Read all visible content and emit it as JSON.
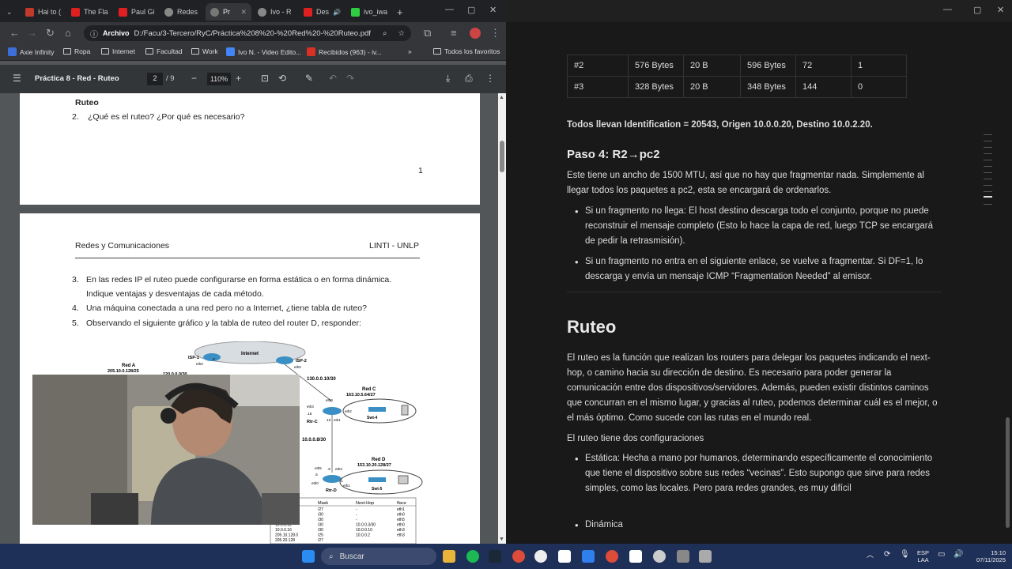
{
  "browser": {
    "tabs": [
      {
        "label": "Hai to ("
      },
      {
        "label": "The Fla"
      },
      {
        "label": "Paul Gi"
      },
      {
        "label": "Redes"
      },
      {
        "label": "Pr"
      },
      {
        "label": "Ivo - R"
      },
      {
        "label": "Des"
      },
      {
        "label": "ivo_iwa"
      }
    ],
    "address_chip": "Archivo",
    "url": "D:/Facu/3-Tercero/RyC/Práctica%208%20-%20Red%20-%20Ruteo.pdf",
    "bookmarks": [
      "Axie Infinity",
      "Ropa",
      "Internet",
      "Facultad",
      "Work",
      "Ivo N. - Video Edito...",
      "Recibidos (963) - iv..."
    ],
    "all_bookmarks": "Todos los favoritos"
  },
  "pdf": {
    "title": "Práctica 8 - Red - Ruteo",
    "page_current": "2",
    "page_total": "/ 9",
    "zoom": "110%",
    "p1_heading": "Ruteo",
    "p1_q2_num": "2.",
    "p1_q2": "¿Qué es el ruteo? ¿Por qué es necesario?",
    "p1_pagenum": "1",
    "p2_header_left": "Redes y Comunicaciones",
    "p2_header_right": "LINTI - UNLP",
    "q3_num": "3.",
    "q3a": "En las redes IP el ruteo puede configurarse en forma estática o en forma dinámica.",
    "q3b": "Indique ventajas y desventajas de cada método.",
    "q4_num": "4.",
    "q4": "Una máquina conectada a una red pero no a Internet, ¿tiene tabla de ruteo?",
    "q5_num": "5.",
    "q5": "Observando el siguiente gráfico y la tabla de ruteo del router D, responder:",
    "diagram": {
      "internet": "Internet",
      "isp1": "ISP-1",
      "isp2": "ISP-2",
      "red_a": "Red A",
      "red_a_net": "205.10.0.128/25",
      "net_120": "120.0.0.0/30",
      "net_130": "130.0.0.10/30",
      "red_c": "Red C",
      "red_c_net": "163.10.5.64/27",
      "rtr_c": "Rtr-C",
      "swt4": "Swt-4",
      "net_10_8": "10.0.0.8/30",
      "red_d": "Red D",
      "red_d_net": "153.10.20.128/27",
      "rtr_d": "Rtr-D",
      "swt5": "Swt-5",
      "eth0": "eth0",
      "eth1": "eth1",
      "eth2": "eth2",
      "eth3": "eth3",
      "eth5": "eth5",
      "n18": ".18",
      "n10": ".10",
      "n9": ".9",
      "n5": ".5",
      "n1": ".1",
      "n2": ".2",
      "table_headers": [
        "Mask",
        "Next-Hop",
        "Iface"
      ],
      "table_rows": [
        [
          "/27",
          "-",
          "eth1"
        ],
        [
          "/30",
          "-",
          "eth0"
        ],
        [
          "/30",
          "-",
          "eth5"
        ],
        [
          "/30",
          "10.0.0.3/30",
          "eth0"
        ],
        [
          "/30",
          "10.0.0.10",
          "eth3"
        ],
        [
          "/25",
          "10.0.0.2",
          "eth3"
        ],
        [
          "/27",
          "",
          ""
        ]
      ],
      "table_dests": [
        "128",
        ".4",
        ".8",
        "10.0.0.12",
        "10.0.0.16",
        "205.10.128.0",
        "205.20.128"
      ]
    }
  },
  "notes": {
    "table_rows": [
      [
        "#2",
        "576 Bytes",
        "20 B",
        "596 Bytes",
        "72",
        "1"
      ],
      [
        "#3",
        "328 Bytes",
        "20 B",
        "348 Bytes",
        "144",
        "0"
      ]
    ],
    "ident_line": "Todos llevan Identification = 20543, Origen 10.0.0.20, Destino 10.0.2.20.",
    "paso4": "Paso 4: R2→pc2",
    "paso4_p": "Este tiene un ancho de 1500 MTU, así que no hay que fragmentar nada. Simplemente al llegar todos los paquetes a pc2, esta se encargará de ordenarlos.",
    "bullet1": "Si un fragmento no llega: El host destino descarga todo el conjunto, porque no puede reconstruir el mensaje completo (Esto lo hace la capa de red, luego TCP se encargará de pedir la retrasmisión).",
    "bullet2": "Si un fragmento no entra en el siguiente enlace, se vuelve a fragmentar. Si DF=1, lo descarga y envía un mensaje ICMP “Fragmentation Needed” al emisor.",
    "ruteo_title": "Ruteo",
    "ruteo_p": "El ruteo es la función que realizan los routers para delegar los paquetes indicando el next-hop, o camino hacia su dirección de destino. Es necesario para poder generar la comunicación entre dos dispositivos/servidores. Además, pueden existir distintos caminos que concurran en el mismo lugar, y gracias al ruteo, podemos determinar cuál es el mejor, o el más óptimo. Como sucede con las rutas en el mundo real.",
    "config_line": "El ruteo tiene dos configuraciones",
    "estatica": "Estática: Hecha a mano por humanos, determinando específicamente el conocimiento que tiene el dispositivo sobre sus redes “vecinas”. Esto supongo que sirve para redes simples, como las locales. Pero para redes grandes, es muy difícil",
    "dinamica": "Dinámica"
  },
  "taskbar": {
    "search": "Buscar",
    "lang1": "ESP",
    "lang2": "LAA",
    "time": "15:10",
    "date": "07/11/2025"
  },
  "colors": {
    "accent": "#1a73e8",
    "taskbar": "#1f3058",
    "notion_bg": "#191919"
  }
}
